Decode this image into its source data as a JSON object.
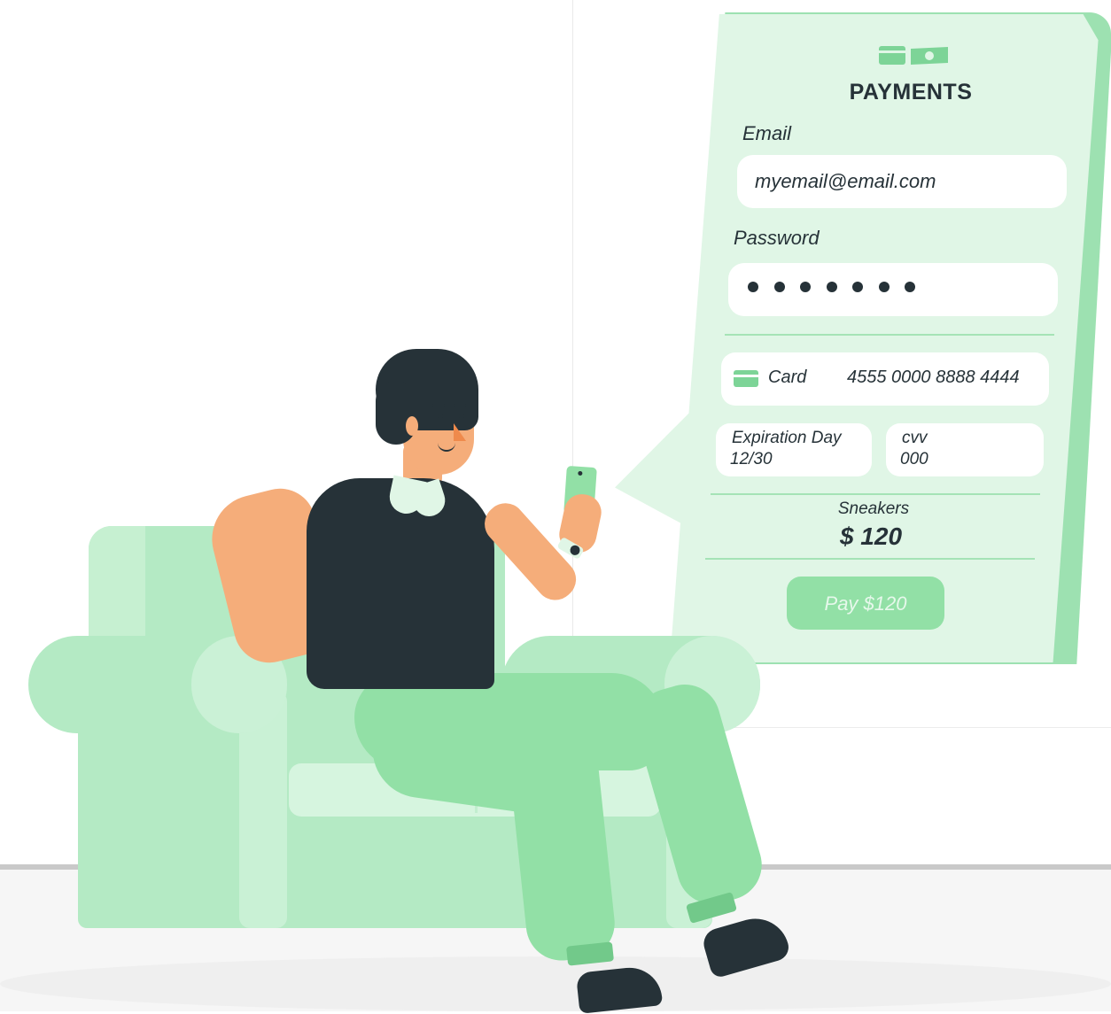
{
  "payment_form": {
    "title": "PAYMENTS",
    "icons": [
      "card-icon",
      "banknote-icon"
    ],
    "email": {
      "label": "Email",
      "value": "myemail@email.com"
    },
    "password": {
      "label": "Password",
      "masked_length": 7
    },
    "card": {
      "icon": "credit-card-icon",
      "label": "Card",
      "number": "4555 0000 8888 4444"
    },
    "expiration": {
      "label": "Expiration Day",
      "value": "12/30"
    },
    "cvv": {
      "label": "cvv",
      "value": "000"
    },
    "product": {
      "name": "Sneakers",
      "price": "$ 120"
    },
    "pay_button": {
      "label": "Pay $120"
    }
  },
  "colors": {
    "panel": "#e0f6e6",
    "accent": "#92e0a6",
    "accent_dark": "#7dd497",
    "text": "#263238",
    "skin": "#f5ad7a",
    "sofa": "#b4eac4"
  }
}
